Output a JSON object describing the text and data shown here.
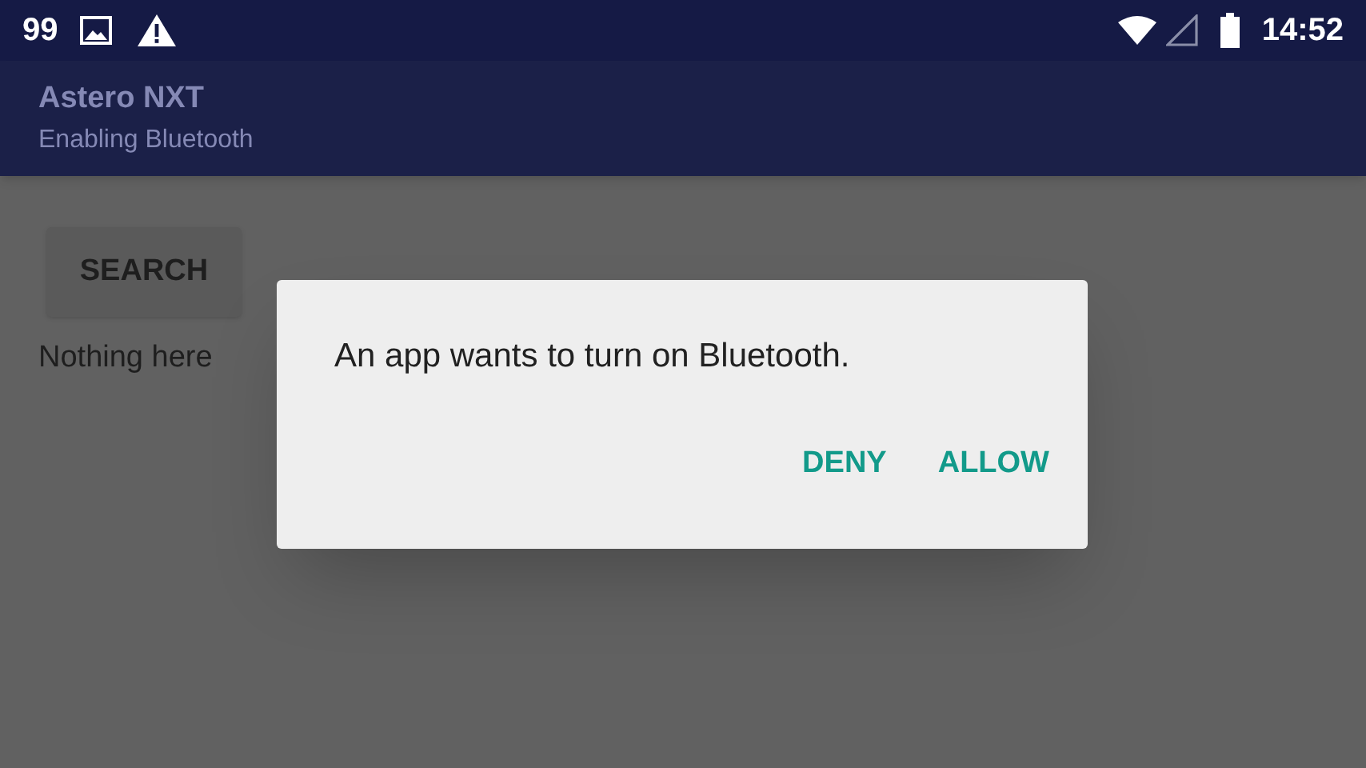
{
  "status_bar": {
    "notification_count": "99",
    "time": "14:52"
  },
  "app_bar": {
    "title": "Astero NXT",
    "subtitle": "Enabling Bluetooth"
  },
  "content": {
    "search_button": "SEARCH",
    "empty_text": "Nothing here"
  },
  "dialog": {
    "message": "An app wants to turn on Bluetooth.",
    "buttons": [
      "DENY",
      "ALLOW"
    ]
  }
}
